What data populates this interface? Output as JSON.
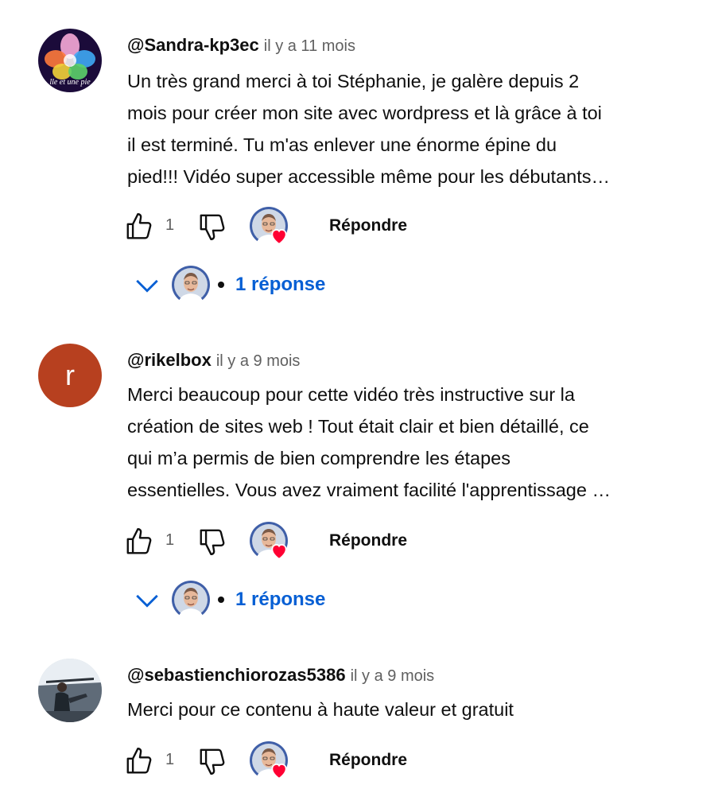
{
  "comments": [
    {
      "author": "@Sandra-kp3ec",
      "time": "il y a 11 mois",
      "avatar_text": "lle et une pie",
      "lines": [
        "Un très grand merci à toi Stéphanie, je galère depuis 2",
        "mois pour créer mon site avec wordpress et là grâce à toi",
        "il est terminé. Tu m'as enlever une énorme épine du",
        "pied!!! Vidéo super accessible même pour les débutants…"
      ],
      "likes": "1",
      "reply_label": "Répondre",
      "replies_label": "1 réponse"
    },
    {
      "author": "@rikelbox",
      "time": "il y a 9 mois",
      "avatar_letter": "r",
      "lines": [
        "Merci beaucoup pour cette vidéo très instructive sur la",
        "création de sites web ! Tout était clair et bien détaillé, ce",
        "qui m’a permis de bien comprendre les étapes",
        "essentielles. Vous avez vraiment facilité l'apprentissage …"
      ],
      "likes": "1",
      "reply_label": "Répondre",
      "replies_label": "1 réponse"
    },
    {
      "author": "@sebastienchiorozas5386",
      "time": "il y a 9 mois",
      "lines": [
        "Merci pour ce contenu à haute valeur et gratuit"
      ],
      "likes": "1",
      "reply_label": "Répondre"
    }
  ],
  "colors": {
    "link_blue": "#065fd4",
    "heart_red": "#ff0033",
    "letter_avatar_bg": "#b7401f",
    "secondary_text": "#606060"
  }
}
